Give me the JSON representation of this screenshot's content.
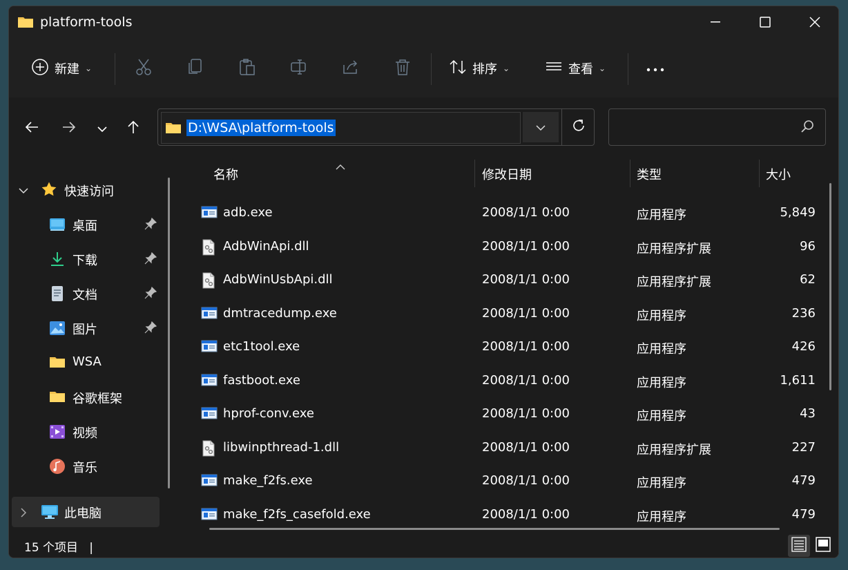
{
  "window": {
    "title": "platform-tools"
  },
  "toolbar": {
    "new_label": "新建",
    "sort_label": "排序",
    "view_label": "查看",
    "more_icon": "more-icon"
  },
  "nav": {
    "address": "D:\\WSA\\platform-tools",
    "search_placeholder": ""
  },
  "sidebar": {
    "quick_access": "快速访问",
    "items": [
      {
        "label": "桌面",
        "icon": "desktop-icon",
        "pinned": true
      },
      {
        "label": "下载",
        "icon": "download-icon",
        "pinned": true
      },
      {
        "label": "文档",
        "icon": "document-icon",
        "pinned": true
      },
      {
        "label": "图片",
        "icon": "picture-icon",
        "pinned": true
      },
      {
        "label": "WSA",
        "icon": "folder-icon",
        "pinned": false
      },
      {
        "label": "谷歌框架",
        "icon": "folder-icon",
        "pinned": false
      },
      {
        "label": "视频",
        "icon": "video-icon",
        "pinned": false
      },
      {
        "label": "音乐",
        "icon": "music-icon",
        "pinned": false
      }
    ],
    "this_pc": "此电脑"
  },
  "columns": {
    "name": "名称",
    "date": "修改日期",
    "type": "类型",
    "size": "大小"
  },
  "files": [
    {
      "name": "adb.exe",
      "date": "2008/1/1 0:00",
      "type": "应用程序",
      "size": "5,849",
      "kind": "exe"
    },
    {
      "name": "AdbWinApi.dll",
      "date": "2008/1/1 0:00",
      "type": "应用程序扩展",
      "size": "96",
      "kind": "dll"
    },
    {
      "name": "AdbWinUsbApi.dll",
      "date": "2008/1/1 0:00",
      "type": "应用程序扩展",
      "size": "62",
      "kind": "dll"
    },
    {
      "name": "dmtracedump.exe",
      "date": "2008/1/1 0:00",
      "type": "应用程序",
      "size": "236",
      "kind": "exe"
    },
    {
      "name": "etc1tool.exe",
      "date": "2008/1/1 0:00",
      "type": "应用程序",
      "size": "426",
      "kind": "exe"
    },
    {
      "name": "fastboot.exe",
      "date": "2008/1/1 0:00",
      "type": "应用程序",
      "size": "1,611",
      "kind": "exe"
    },
    {
      "name": "hprof-conv.exe",
      "date": "2008/1/1 0:00",
      "type": "应用程序",
      "size": "43",
      "kind": "exe"
    },
    {
      "name": "libwinpthread-1.dll",
      "date": "2008/1/1 0:00",
      "type": "应用程序扩展",
      "size": "227",
      "kind": "dll"
    },
    {
      "name": "make_f2fs.exe",
      "date": "2008/1/1 0:00",
      "type": "应用程序",
      "size": "479",
      "kind": "exe"
    },
    {
      "name": "make_f2fs_casefold.exe",
      "date": "2008/1/1 0:00",
      "type": "应用程序",
      "size": "479",
      "kind": "exe"
    }
  ],
  "status": {
    "item_count": "15 个项目",
    "separator": "|"
  },
  "colors": {
    "selection": "#0063d6",
    "folder": "#f2c14e",
    "background": "#1c1c1c"
  }
}
